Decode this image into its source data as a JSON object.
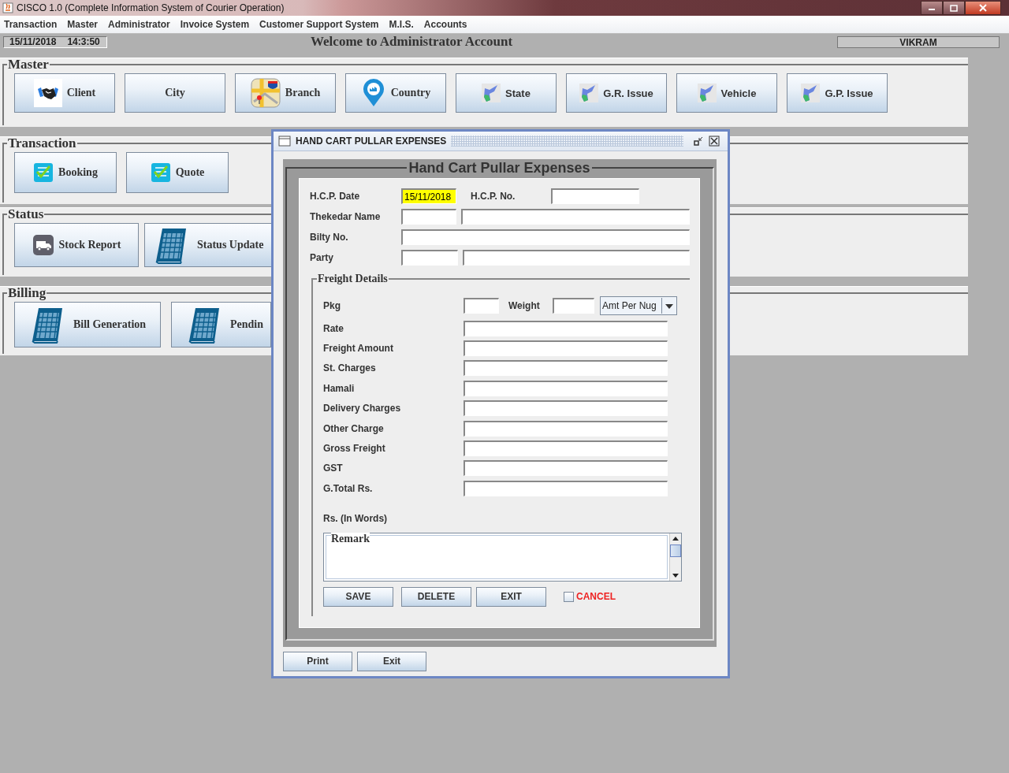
{
  "window": {
    "title": "CISCO 1.0 (Complete Information System of Courier Operation)"
  },
  "menu": [
    {
      "label": "Transaction"
    },
    {
      "label": "Master"
    },
    {
      "label": "Administrator"
    },
    {
      "label": "Invoice System"
    },
    {
      "label": "Customer Support System"
    },
    {
      "label": "M.I.S."
    },
    {
      "label": "Accounts"
    }
  ],
  "status_bar": {
    "date": "15/11/2018",
    "time": "14:3:50",
    "welcome": "Welcome to Administrator Account",
    "user": "VIKRAM"
  },
  "sections": [
    {
      "title": "Master",
      "buttons": [
        {
          "label": "Client",
          "kind": "handshake"
        },
        {
          "label": "City",
          "kind": "plain"
        },
        {
          "label": "Branch",
          "kind": "map"
        },
        {
          "label": "Country",
          "kind": "pin"
        },
        {
          "label": "State",
          "kind": "flag"
        },
        {
          "label": "G.R. Issue",
          "kind": "flag"
        },
        {
          "label": "Vehicle",
          "kind": "flag"
        },
        {
          "label": "G.P. Issue",
          "kind": "flag"
        }
      ]
    },
    {
      "title": "Transaction",
      "buttons": [
        {
          "label": "Booking",
          "kind": "checklist"
        },
        {
          "label": "Quote",
          "kind": "checklist"
        }
      ]
    },
    {
      "title": "Status",
      "buttons": [
        {
          "label": "Stock Report",
          "kind": "truck"
        },
        {
          "label": "Status Update",
          "kind": "calendar"
        }
      ]
    },
    {
      "title": "Billing",
      "buttons": [
        {
          "label": "Bill Generation",
          "kind": "calendar"
        },
        {
          "label": "Pendin",
          "kind": "calendar"
        }
      ]
    }
  ],
  "dialog": {
    "title": "HAND CART PULLAR EXPENSES",
    "heading": "Hand Cart Pullar Expenses",
    "header": {
      "hcp_date": {
        "label": "H.C.P. Date",
        "value": "15/11/2018",
        "highlighted": true
      },
      "hcp_no": {
        "label": "H.C.P. No."
      },
      "thekedar": {
        "label": "Thekedar Name"
      },
      "bilty": {
        "label": "Bilty No."
      },
      "party": {
        "label": "Party"
      }
    },
    "freight": {
      "legend": "Freight Details",
      "pkg": {
        "label": "Pkg"
      },
      "weight": {
        "label": "Weight"
      },
      "unit": {
        "value": "Amt Per Nug"
      },
      "rows": [
        {
          "label": "Rate"
        },
        {
          "label": "Freight Amount"
        },
        {
          "label": "St. Charges"
        },
        {
          "label": "Hamali"
        },
        {
          "label": "Delivery Charges"
        },
        {
          "label": "Other Charge"
        },
        {
          "label": "Gross Freight"
        },
        {
          "label": "GST"
        },
        {
          "label": "G.Total Rs."
        }
      ],
      "words_label": "Rs. (In Words)",
      "remark": {
        "legend": "Remark"
      },
      "buttons": [
        {
          "label": "SAVE"
        },
        {
          "label": "DELETE"
        },
        {
          "label": "EXIT"
        }
      ],
      "cancel": {
        "label": "CANCEL",
        "checked": false
      }
    },
    "footer_buttons": [
      {
        "label": "Print"
      },
      {
        "label": "Exit"
      }
    ]
  }
}
